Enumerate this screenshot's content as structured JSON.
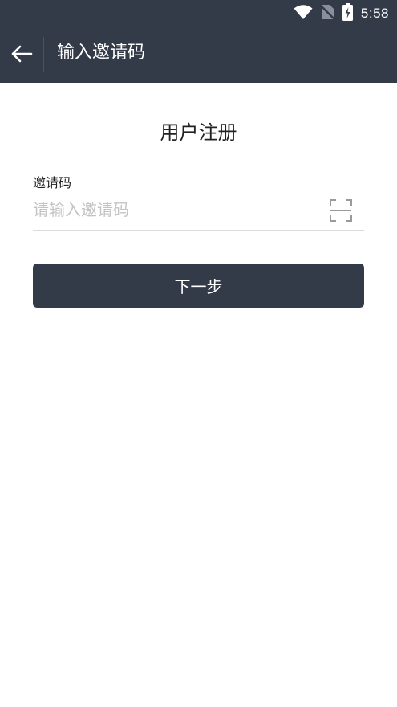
{
  "status_bar": {
    "time": "5:58",
    "icons": [
      "wifi-icon",
      "no-sim-icon",
      "battery-charging-icon"
    ]
  },
  "app_bar": {
    "back_icon": "arrow-left-icon",
    "title": "输入邀请码"
  },
  "page": {
    "title": "用户注册"
  },
  "invite_field": {
    "label": "邀请码",
    "value": "",
    "placeholder": "请输入邀请码",
    "scan_icon": "scan-icon"
  },
  "next_button": {
    "label": "下一步"
  },
  "colors": {
    "primary": "#333a48",
    "background": "#ffffff",
    "text": "#222222",
    "placeholder": "#c4c4c4",
    "divider": "#dcdcdc"
  }
}
